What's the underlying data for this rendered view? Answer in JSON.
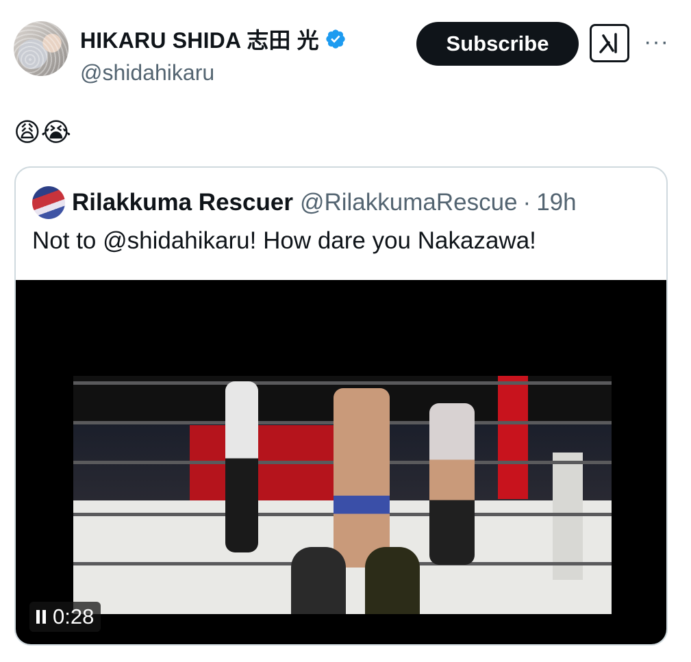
{
  "author": {
    "display_name": "HIKARU SHIDA 志田 光",
    "handle": "@shidahikaru",
    "verified": true,
    "verified_color": "#1d9bf0"
  },
  "actions": {
    "subscribe_label": "Subscribe",
    "grok_icon": "grok-icon",
    "more_icon": "more-icon",
    "more_label": "···"
  },
  "tweet": {
    "text": "😩😭"
  },
  "quote": {
    "name": "Rilakkuma Rescuer",
    "handle": "@RilakkumaRescue",
    "separator": "·",
    "time": "19h",
    "text": "Not to @shidahikaru! How dare you Nakazawa!",
    "video": {
      "time": "0:28",
      "state_icon": "pause-icon"
    }
  },
  "colors": {
    "text": "#0f1419",
    "muted": "#536471",
    "border": "#cfd9de",
    "subscribe_bg": "#0f1419"
  }
}
